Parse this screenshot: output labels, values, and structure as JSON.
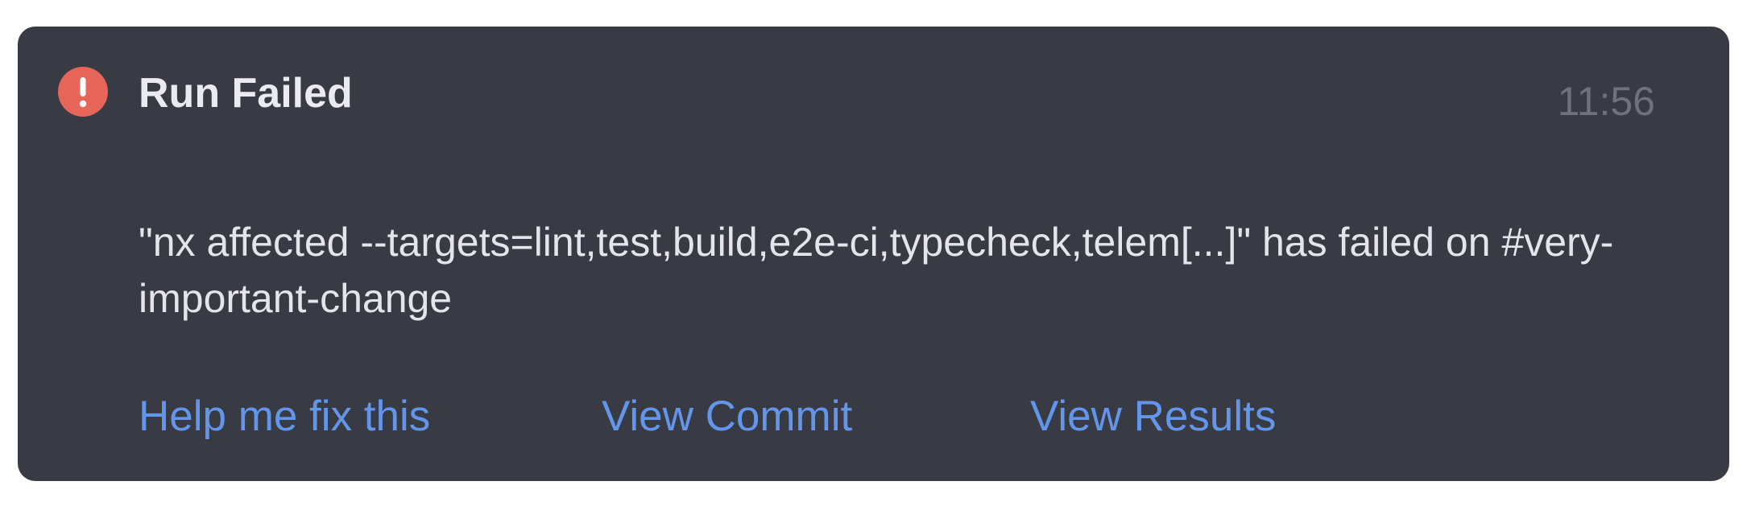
{
  "notification": {
    "title": "Run Failed",
    "timestamp": "11:56",
    "message": "\"nx affected --targets=lint,test,build,e2e-ci,typecheck,telem[...]\" has failed on #very-important-change",
    "status_icon": "error-exclamation-icon",
    "colors": {
      "background": "#393b44",
      "error_accent": "#e8655a",
      "link": "#6396ea"
    },
    "actions": {
      "help_label": "Help me fix this",
      "commit_label": "View Commit",
      "results_label": "View Results"
    }
  }
}
